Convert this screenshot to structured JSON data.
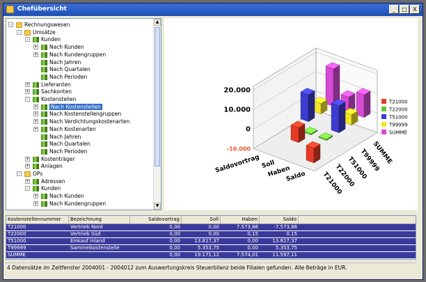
{
  "window": {
    "title": "Chefübersicht",
    "min_label": "_",
    "max_label": "□",
    "close_label": "X"
  },
  "tree": [
    {
      "label": "Rechnungswesen",
      "icon": "folder",
      "exp": "-",
      "selected": false
    },
    {
      "label": "Umsätze",
      "icon": "folder",
      "exp": "-",
      "selected": false
    },
    {
      "label": "Kunden",
      "icon": "leaf",
      "exp": "-",
      "selected": false
    },
    {
      "label": "Nach Kunden",
      "icon": "leaf",
      "exp": "+",
      "selected": false
    },
    {
      "label": "Nach Kundengruppen",
      "icon": "leaf",
      "exp": "+",
      "selected": false
    },
    {
      "label": "Nach Jahren",
      "icon": "leaf",
      "exp": "",
      "selected": false
    },
    {
      "label": "Nach Quartalen",
      "icon": "leaf",
      "exp": "",
      "selected": false
    },
    {
      "label": "Nach Perioden",
      "icon": "leaf",
      "exp": "",
      "selected": false
    },
    {
      "label": "Lieferanten",
      "icon": "leaf",
      "exp": "+",
      "selected": false
    },
    {
      "label": "Sachkonten",
      "icon": "leaf",
      "exp": "+",
      "selected": false
    },
    {
      "label": "Kostenstellen",
      "icon": "leaf",
      "exp": "-",
      "selected": false
    },
    {
      "label": "Nach Kostenstellen",
      "icon": "leaf",
      "exp": "+",
      "selected": true
    },
    {
      "label": "Nach Kostenstellengruppen",
      "icon": "leaf",
      "exp": "+",
      "selected": false
    },
    {
      "label": "Nach Verdichtungskostenarten",
      "icon": "leaf",
      "exp": "+",
      "selected": false
    },
    {
      "label": "Nach Kostenarten",
      "icon": "leaf",
      "exp": "+",
      "selected": false
    },
    {
      "label": "Nach Jahren",
      "icon": "leaf",
      "exp": "",
      "selected": false
    },
    {
      "label": "Nach Quartalen",
      "icon": "leaf",
      "exp": "",
      "selected": false
    },
    {
      "label": "Nach Perioden",
      "icon": "leaf",
      "exp": "",
      "selected": false
    },
    {
      "label": "Kostenträger",
      "icon": "leaf",
      "exp": "+",
      "selected": false
    },
    {
      "label": "Anlagen",
      "icon": "leaf",
      "exp": "+",
      "selected": false
    },
    {
      "label": "OPs",
      "icon": "folder",
      "exp": "-",
      "selected": false
    },
    {
      "label": "Adressen",
      "icon": "leaf",
      "exp": "+",
      "selected": false
    },
    {
      "label": "Kunden",
      "icon": "leaf",
      "exp": "-",
      "selected": false
    },
    {
      "label": "Nach Kunden",
      "icon": "leaf",
      "exp": "+",
      "selected": false
    },
    {
      "label": "Nach Kundengruppen",
      "icon": "leaf",
      "exp": "+",
      "selected": false
    }
  ],
  "chart_data": {
    "type": "bar",
    "categories": [
      "Saldovortrag",
      "Soll",
      "Haben",
      "Saldo"
    ],
    "series": [
      {
        "name": "T21000",
        "color": "#e53a25",
        "values": [
          0,
          0,
          7573.86,
          -7573.86
        ]
      },
      {
        "name": "T22000",
        "color": "#6ac23a",
        "values": [
          0,
          0,
          0.15,
          0.15
        ]
      },
      {
        "name": "T51000",
        "color": "#3c3ccf",
        "values": [
          0,
          13817.37,
          0,
          13817.37
        ]
      },
      {
        "name": "T99999",
        "color": "#f2e526",
        "values": [
          0,
          5353.75,
          0,
          5353.75
        ]
      },
      {
        "name": "SUMME",
        "color": "#d64ad6",
        "values": [
          0,
          19171.12,
          7574.01,
          11597.11
        ]
      }
    ],
    "ytick_labels": [
      "-10.000",
      "0",
      "10.000",
      "20.000"
    ],
    "ylim": [
      -10000,
      20000
    ],
    "legend_position": "right"
  },
  "table": {
    "headers": [
      "Kostenstellennummer",
      "Bezeichnung",
      "Saldovortrag",
      "Soll",
      "Haben",
      "Saldo"
    ],
    "rows": [
      [
        "T21000",
        "Vertrieb Nord",
        "0,00",
        "0,00",
        "7.573,86",
        "-7.573,86"
      ],
      [
        "T22000",
        "Vertrieb Süd",
        "0,00",
        "0,00",
        "0,15",
        "0,15"
      ],
      [
        "T51000",
        "Einkauf Inland",
        "0,00",
        "13.817,37",
        "0,00",
        "13.817,37"
      ],
      [
        "T99999",
        "Sammelkostenstelle",
        "0,00",
        "5.353,75",
        "0,00",
        "5.353,75"
      ],
      [
        "SUMME",
        "",
        "0,00",
        "19.171,12",
        "7.574,01",
        "11.597,11"
      ]
    ]
  },
  "status": "4 Datensätze im Zeitfenster 2004001 - 2004012 zum Auswertungskreis Steuerbilanz beide Filialen gefunden. Alle Beträge in EUR."
}
